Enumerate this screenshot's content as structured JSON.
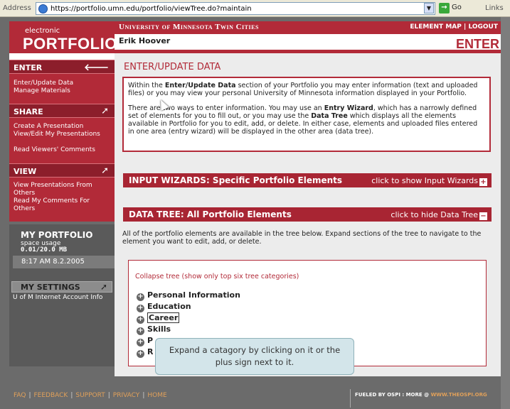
{
  "browser": {
    "address_label": "Address",
    "url": "https://portfolio.umn.edu/portfolio/viewTree.do?maintain",
    "go_label": "Go",
    "links_label": "Links"
  },
  "logo": {
    "small": "electronic",
    "big": "PORTFOLIO"
  },
  "header": {
    "university": "University of Minnesota Twin Cities",
    "element_map": "ELEMENT MAP",
    "logout": "LOGOUT",
    "separator": "|",
    "user_name": "Erik Hoover",
    "section": "ENTER"
  },
  "nav": {
    "enter": {
      "label": "ENTER",
      "links": [
        "Enter/Update Data",
        "Manage Materials"
      ]
    },
    "share": {
      "label": "SHARE",
      "links": [
        "Create A Presentation",
        "View/Edit My Presentations",
        "Read Viewers' Comments"
      ]
    },
    "view": {
      "label": "VIEW",
      "links": [
        "View Presentations From Others",
        "Read My Comments For Others"
      ]
    }
  },
  "my_portfolio": {
    "title": "MY PORTFOLIO",
    "usage_label": "space usage",
    "usage_value": "0.01/20.0 MB",
    "datetime": "8:17 AM 8.2.2005",
    "settings_label": "MY SETTINGS",
    "settings_link": "U of M Internet Account Info"
  },
  "main": {
    "title": "ENTER/UPDATE DATA",
    "intro_p1_pre": "Within the ",
    "intro_p1_bold": "Enter/Update Data",
    "intro_p1_post": " section of your Portfolio you may enter information (text and uploaded files) or you may view your personal University of Minnesota information displayed in your Portfolio.",
    "intro_p2_a": "There are two ways to enter information. You may use an ",
    "intro_p2_bold1": "Entry Wizard",
    "intro_p2_b": ", which has a narrowly defined set of elements for you to fill out, or you may use the ",
    "intro_p2_bold2": "Data Tree",
    "intro_p2_c": " which displays all the elements available in Portfolio for you to edit, add, or delete. In either case, elements and uploaded files entered in one area (entry wizard) will be displayed in the other area (data tree).",
    "wizard_bar": {
      "title": "INPUT WIZARDS: Specific Portfolio Elements",
      "action": "click to show Input Wizards"
    },
    "tree_bar": {
      "title": "DATA TREE: All Portfolio Elements",
      "action": "click to hide Data Tree"
    },
    "tree_intro": "All of the portfolio elements are available in the tree below. Expand sections of the tree to navigate to the element you want to edit, add, or delete.",
    "collapse_link": "Collapse tree (show only top six tree categories)",
    "tree_items": [
      "Personal Information",
      "Education",
      "Career",
      "Skills",
      "P",
      "R"
    ]
  },
  "tooltip": {
    "text": "Expand a catagory by clicking on it or the plus sign next to it."
  },
  "footer": {
    "links": [
      "FAQ",
      "FEEDBACK",
      "SUPPORT",
      "PRIVACY",
      "HOME"
    ],
    "powered": "FUELED BY OSPI : MORE @ ",
    "site": "WWW.THEOSPI.ORG"
  },
  "colors": {
    "brand_red": "#b22a38",
    "dark_red": "#8c1e2b",
    "grey": "#6b6b6b",
    "tooltip_bg": "#d3e5ea"
  }
}
